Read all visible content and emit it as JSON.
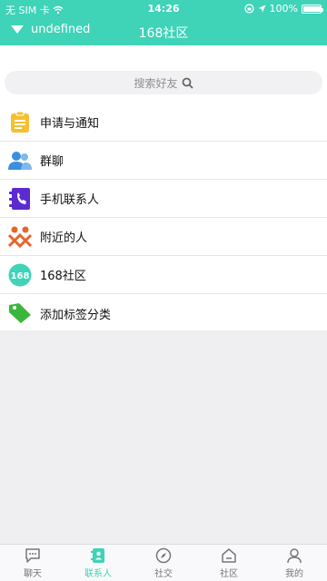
{
  "status_bar": {
    "carrier": "无 SIM 卡",
    "time": "14:26",
    "battery": "100%",
    "battery_level": 1.0
  },
  "nav": {
    "user_label": "undefined",
    "title": "168社区"
  },
  "search": {
    "placeholder": "搜索好友"
  },
  "list": [
    {
      "label": "申请与通知",
      "icon": "clipboard-icon"
    },
    {
      "label": "群聊",
      "icon": "group-icon"
    },
    {
      "label": "手机联系人",
      "icon": "phone-contacts-icon"
    },
    {
      "label": "附近的人",
      "icon": "nearby-people-icon"
    },
    {
      "label": "168社区",
      "icon": "community-168-icon"
    },
    {
      "label": "添加标签分类",
      "icon": "tag-icon"
    }
  ],
  "community_badge_text": "168",
  "tabs": [
    {
      "label": "聊天",
      "icon": "chat-icon",
      "active": false
    },
    {
      "label": "联系人",
      "icon": "contacts-icon",
      "active": true
    },
    {
      "label": "社交",
      "icon": "compass-icon",
      "active": false
    },
    {
      "label": "社区",
      "icon": "home-icon",
      "active": false
    },
    {
      "label": "我的",
      "icon": "user-icon",
      "active": false
    }
  ],
  "colors": {
    "accent": "#3fd3b8",
    "notice_icon": "#f5c02f",
    "group_icon": "#3a8fe0",
    "phone_icon": "#5b2bd1",
    "nearby_icon": "#e8652a",
    "community_icon": "#3fd3b8",
    "tag_icon": "#3cb53c"
  }
}
